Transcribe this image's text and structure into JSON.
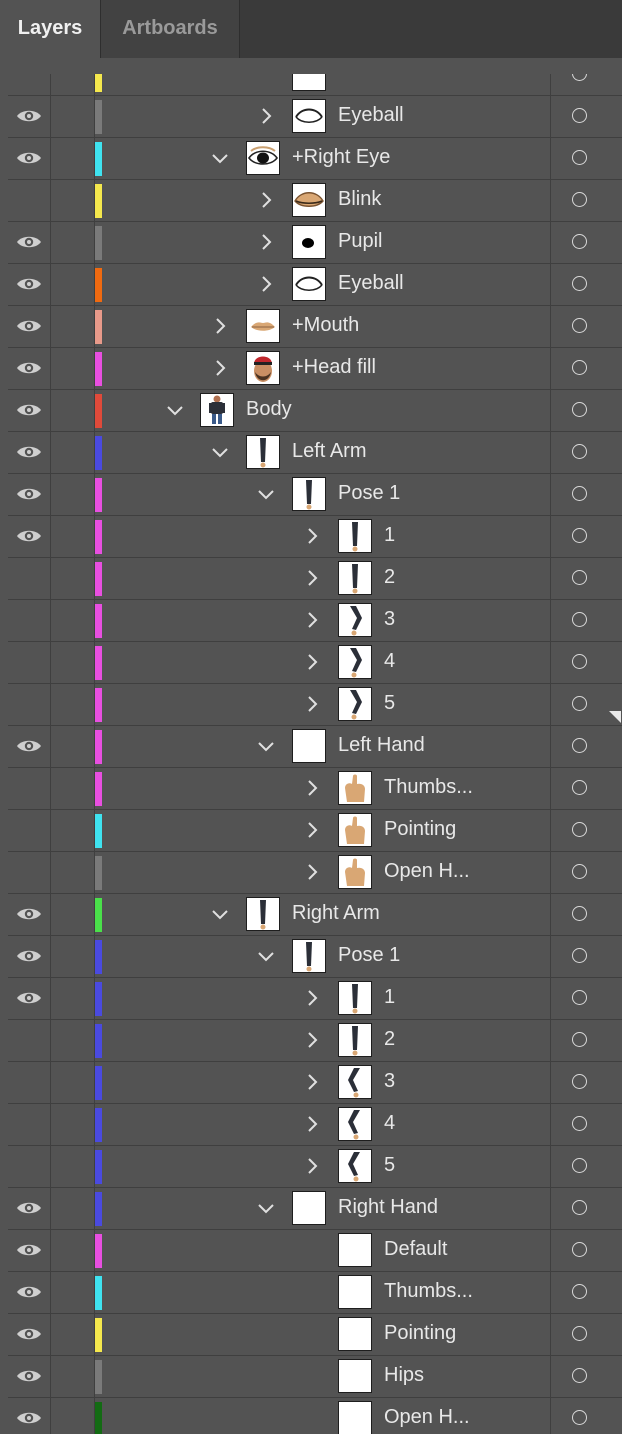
{
  "tabs": [
    {
      "label": "Layers",
      "active": true
    },
    {
      "label": "Artboards",
      "active": false
    }
  ],
  "layers": [
    {
      "label": "",
      "depth": 3,
      "visible": false,
      "color": "#f5e84d",
      "expander": "none",
      "thumb": "partial"
    },
    {
      "label": "Eyeball",
      "depth": 3,
      "visible": true,
      "color": "#7a7a7a",
      "expander": "collapsed",
      "thumb": "eyeball"
    },
    {
      "label": "+Right Eye",
      "depth": 2,
      "visible": true,
      "color": "#3fe3f0",
      "expander": "expanded",
      "thumb": "eye"
    },
    {
      "label": "Blink",
      "depth": 3,
      "visible": false,
      "color": "#f5e84d",
      "expander": "collapsed",
      "thumb": "blink"
    },
    {
      "label": "Pupil",
      "depth": 3,
      "visible": true,
      "color": "#7a7a7a",
      "expander": "collapsed",
      "thumb": "pupil"
    },
    {
      "label": "Eyeball",
      "depth": 3,
      "visible": true,
      "color": "#f06a10",
      "expander": "collapsed",
      "thumb": "eyeball"
    },
    {
      "label": "+Mouth",
      "depth": 2,
      "visible": true,
      "color": "#e89a8a",
      "expander": "collapsed",
      "thumb": "mouth"
    },
    {
      "label": "+Head fill",
      "depth": 2,
      "visible": true,
      "color": "#e84fe0",
      "expander": "collapsed",
      "thumb": "head"
    },
    {
      "label": "Body",
      "depth": 1,
      "visible": true,
      "color": "#e04a3a",
      "expander": "expanded",
      "thumb": "body"
    },
    {
      "label": "Left Arm",
      "depth": 2,
      "visible": true,
      "color": "#4a4adf",
      "expander": "expanded",
      "thumb": "arm"
    },
    {
      "label": "Pose 1",
      "depth": 3,
      "visible": true,
      "color": "#e84fe0",
      "expander": "expanded",
      "thumb": "arm"
    },
    {
      "label": "1",
      "depth": 4,
      "visible": true,
      "color": "#e84fe0",
      "expander": "collapsed",
      "thumb": "arm"
    },
    {
      "label": "2",
      "depth": 4,
      "visible": false,
      "color": "#e84fe0",
      "expander": "collapsed",
      "thumb": "arm"
    },
    {
      "label": "3",
      "depth": 4,
      "visible": false,
      "color": "#e84fe0",
      "expander": "collapsed",
      "thumb": "armbent"
    },
    {
      "label": "4",
      "depth": 4,
      "visible": false,
      "color": "#e84fe0",
      "expander": "collapsed",
      "thumb": "armbent"
    },
    {
      "label": "5",
      "depth": 4,
      "visible": false,
      "color": "#e84fe0",
      "expander": "collapsed",
      "thumb": "armbent"
    },
    {
      "label": "Left Hand",
      "depth": 3,
      "visible": true,
      "color": "#e84fe0",
      "expander": "expanded",
      "thumb": "blank"
    },
    {
      "label": "Thumbs...",
      "depth": 4,
      "visible": false,
      "color": "#e84fe0",
      "expander": "collapsed",
      "thumb": "hand"
    },
    {
      "label": "Pointing",
      "depth": 4,
      "visible": false,
      "color": "#3fe3f0",
      "expander": "collapsed",
      "thumb": "hand"
    },
    {
      "label": "Open H...",
      "depth": 4,
      "visible": false,
      "color": "#7a7a7a",
      "expander": "collapsed",
      "thumb": "hand"
    },
    {
      "label": "Right Arm",
      "depth": 2,
      "visible": true,
      "color": "#4ae04a",
      "expander": "expanded",
      "thumb": "arm"
    },
    {
      "label": "Pose 1",
      "depth": 3,
      "visible": true,
      "color": "#4a4adf",
      "expander": "expanded",
      "thumb": "arm"
    },
    {
      "label": "1",
      "depth": 4,
      "visible": true,
      "color": "#4a4adf",
      "expander": "collapsed",
      "thumb": "arm"
    },
    {
      "label": "2",
      "depth": 4,
      "visible": false,
      "color": "#4a4adf",
      "expander": "collapsed",
      "thumb": "arm"
    },
    {
      "label": "3",
      "depth": 4,
      "visible": false,
      "color": "#4a4adf",
      "expander": "collapsed",
      "thumb": "armbentl"
    },
    {
      "label": "4",
      "depth": 4,
      "visible": false,
      "color": "#4a4adf",
      "expander": "collapsed",
      "thumb": "armbentl"
    },
    {
      "label": "5",
      "depth": 4,
      "visible": false,
      "color": "#4a4adf",
      "expander": "collapsed",
      "thumb": "armbentl"
    },
    {
      "label": "Right Hand",
      "depth": 3,
      "visible": true,
      "color": "#4a4adf",
      "expander": "expanded",
      "thumb": "blank"
    },
    {
      "label": "Default",
      "depth": 4,
      "visible": true,
      "color": "#e84fe0",
      "expander": "none",
      "thumb": "blank"
    },
    {
      "label": "Thumbs...",
      "depth": 4,
      "visible": true,
      "color": "#3fe3f0",
      "expander": "none",
      "thumb": "blank"
    },
    {
      "label": "Pointing",
      "depth": 4,
      "visible": true,
      "color": "#f5e84d",
      "expander": "none",
      "thumb": "blank"
    },
    {
      "label": "Hips",
      "depth": 4,
      "visible": true,
      "color": "#7a7a7a",
      "expander": "none",
      "thumb": "blank"
    },
    {
      "label": "Open H...",
      "depth": 4,
      "visible": true,
      "color": "#136b13",
      "expander": "none",
      "thumb": "blank"
    },
    {
      "label": "",
      "depth": 2,
      "visible": false,
      "color": "#4ae04a",
      "expander": "none",
      "thumb": "hand"
    }
  ]
}
